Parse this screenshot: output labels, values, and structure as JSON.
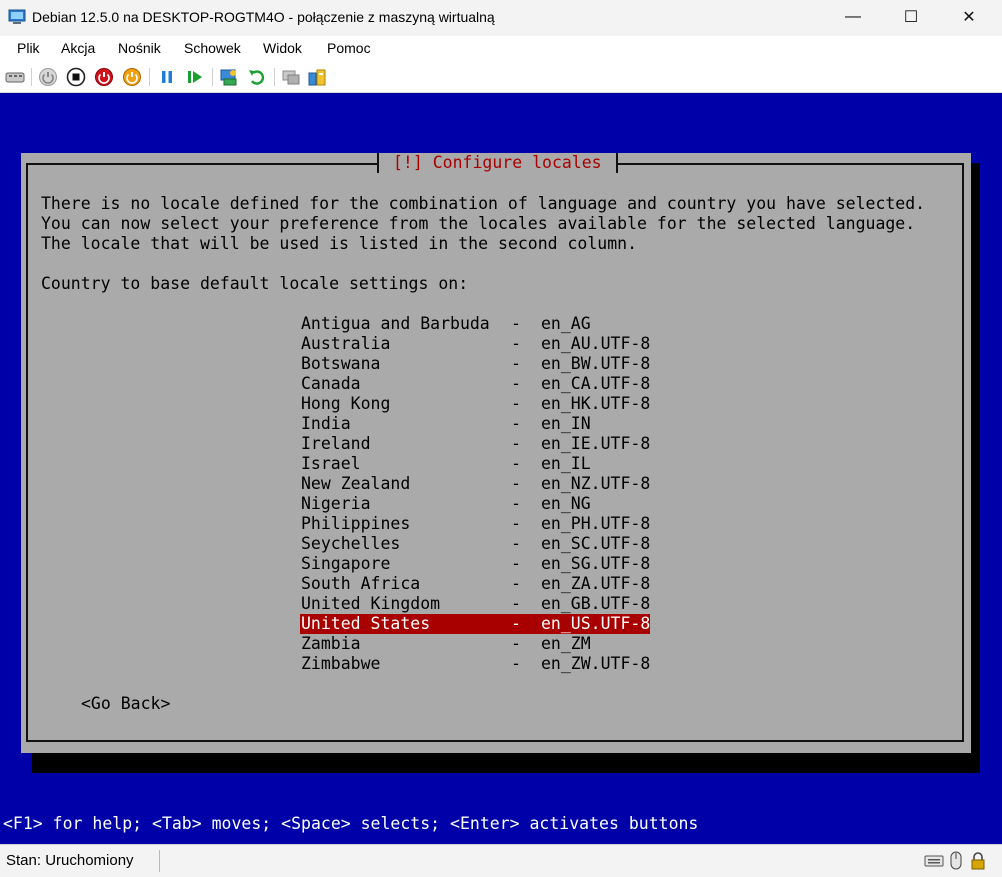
{
  "window": {
    "title": "Debian 12.5.0 na DESKTOP-ROGTM4O - połączenie z maszyną wirtualną",
    "minimize_glyph": "—",
    "maximize_glyph": "☐",
    "close_glyph": "✕"
  },
  "menu": {
    "items": [
      "Plik",
      "Akcja",
      "Nośnik",
      "Schowek",
      "Widok",
      "Pomoc"
    ]
  },
  "toolbar": {
    "icons": [
      "ctrl-alt-del-icon",
      "start-icon",
      "turn-off-icon",
      "shut-down-icon",
      "save-state-icon",
      "pause-icon",
      "resume-icon",
      "checkpoint-icon",
      "revert-icon",
      "enhanced-session-icon",
      "share-icon"
    ]
  },
  "installer": {
    "dialog_title": "[!] Configure locales",
    "description": [
      "There is no locale defined for the combination of language and country you have selected.",
      "You can now select your preference from the locales available for the selected language.",
      "The locale that will be used is listed in the second column."
    ],
    "prompt": "Country to base default locale settings on:",
    "dash": "-",
    "selected_index": 15,
    "locales": [
      {
        "country": "Antigua and Barbuda",
        "code": "en_AG"
      },
      {
        "country": "Australia",
        "code": "en_AU.UTF-8"
      },
      {
        "country": "Botswana",
        "code": "en_BW.UTF-8"
      },
      {
        "country": "Canada",
        "code": "en_CA.UTF-8"
      },
      {
        "country": "Hong Kong",
        "code": "en_HK.UTF-8"
      },
      {
        "country": "India",
        "code": "en_IN"
      },
      {
        "country": "Ireland",
        "code": "en_IE.UTF-8"
      },
      {
        "country": "Israel",
        "code": "en_IL"
      },
      {
        "country": "New Zealand",
        "code": "en_NZ.UTF-8"
      },
      {
        "country": "Nigeria",
        "code": "en_NG"
      },
      {
        "country": "Philippines",
        "code": "en_PH.UTF-8"
      },
      {
        "country": "Seychelles",
        "code": "en_SC.UTF-8"
      },
      {
        "country": "Singapore",
        "code": "en_SG.UTF-8"
      },
      {
        "country": "South Africa",
        "code": "en_ZA.UTF-8"
      },
      {
        "country": "United Kingdom",
        "code": "en_GB.UTF-8"
      },
      {
        "country": "United States",
        "code": "en_US.UTF-8"
      },
      {
        "country": "Zambia",
        "code": "en_ZM"
      },
      {
        "country": "Zimbabwe",
        "code": "en_ZW.UTF-8"
      }
    ],
    "go_back": "<Go Back>",
    "help_line": "<F1> for help; <Tab> moves; <Space> selects; <Enter> activates buttons"
  },
  "colors": {
    "screen_bg": "#0000a8",
    "dialog_bg": "#aaaaaa",
    "title_fg": "#a80000",
    "selection_bg": "#a80000",
    "selection_fg": "#ffffff"
  },
  "status": {
    "text": "Stan: Uruchomiony",
    "icons": [
      "keyboard-icon",
      "mouse-icon",
      "lock-icon"
    ]
  }
}
